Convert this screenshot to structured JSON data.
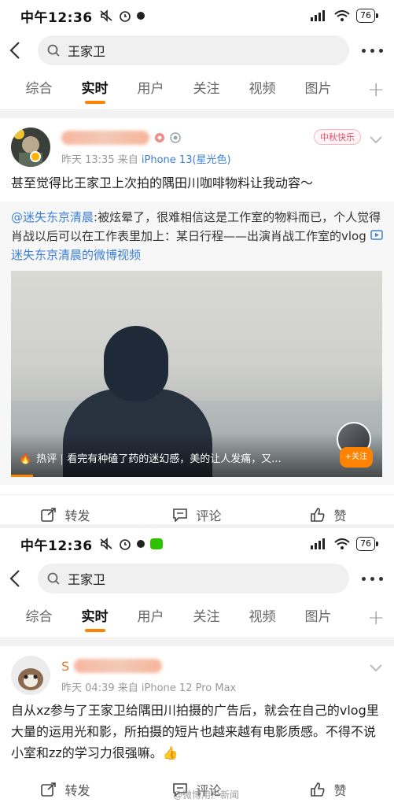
{
  "status": {
    "time": "中午12:36",
    "battery": "76"
  },
  "search": {
    "query": "王家卫"
  },
  "tabs": [
    {
      "label": "综合"
    },
    {
      "label": "实时"
    },
    {
      "label": "用户"
    },
    {
      "label": "关注"
    },
    {
      "label": "视频"
    },
    {
      "label": "图片"
    }
  ],
  "post1": {
    "time": "昨天 13:35",
    "source_prefix": "来自",
    "source": "iPhone 13(星光色)",
    "festival_badge": "中秋快乐",
    "text": "甚至觉得比王家卫上次拍的隅田川咖啡物料让我动容～",
    "repost": {
      "mention": "@迷失东京清晨",
      "text": ":被炫晕了，很难相信这是工作室的物料而已，个人觉得肖战以后可以在工作表里加上：某日行程——出演肖战工作室的vlog",
      "video_link": "迷失东京清晨的微博视频"
    },
    "video": {
      "hot_label": "热评",
      "hot_comment": "看完有种磕了药的迷幻感，美的让人发痛，又...",
      "follow": "+关注"
    },
    "actions": {
      "repost": "转发",
      "comment": "评论",
      "like": "赞"
    }
  },
  "post2": {
    "name_partial": "S",
    "time": "昨天 04:39",
    "source_prefix": "来自",
    "source": "iPhone 12 Pro Max",
    "text": "自从xz参与了王家卫给隅田川拍摄的广告后，就会在自己的vlog里大量的运用光和影，所拍摄的短片也越来越有电影质感。不得不说小室和zz的学习力很强嘛。👍",
    "actions": {
      "repost": "转发",
      "comment": "评论",
      "like": "赞"
    }
  },
  "watermark": "@微博用户新闻"
}
